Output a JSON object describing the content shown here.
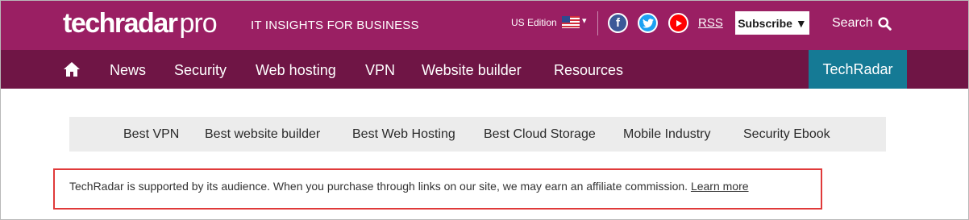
{
  "header": {
    "logo_main": "techradar",
    "logo_sub": "pro",
    "tagline": "IT INSIGHTS FOR BUSINESS",
    "edition": "US Edition",
    "rss_label": "RSS",
    "subscribe_label": "Subscribe",
    "search_label": "Search"
  },
  "nav": {
    "items": [
      {
        "label": "News"
      },
      {
        "label": "Security"
      },
      {
        "label": "Web hosting"
      },
      {
        "label": "VPN"
      },
      {
        "label": "Website builder"
      },
      {
        "label": "Resources"
      }
    ],
    "techradar_label": "TechRadar"
  },
  "subnav": {
    "items": [
      {
        "label": "Best VPN"
      },
      {
        "label": "Best website builder"
      },
      {
        "label": "Best Web Hosting"
      },
      {
        "label": "Best Cloud Storage"
      },
      {
        "label": "Mobile Industry"
      },
      {
        "label": "Security Ebook"
      }
    ]
  },
  "disclaimer": {
    "text": "TechRadar is supported by its audience. When you purchase through links on our site, we may earn an affiliate commission.",
    "link": "Learn more"
  },
  "icons": {
    "home": "home-icon",
    "flag": "us-flag-icon",
    "facebook": "facebook-icon",
    "twitter": "twitter-icon",
    "youtube": "youtube-icon",
    "search": "search-icon",
    "caret": "caret-down-icon"
  },
  "colors": {
    "topbar": "#9a1f63",
    "navbar": "#6f1545",
    "techradar_tab": "#157a95",
    "subnav_bg": "#ececec",
    "highlight_border": "#e03a3a"
  }
}
